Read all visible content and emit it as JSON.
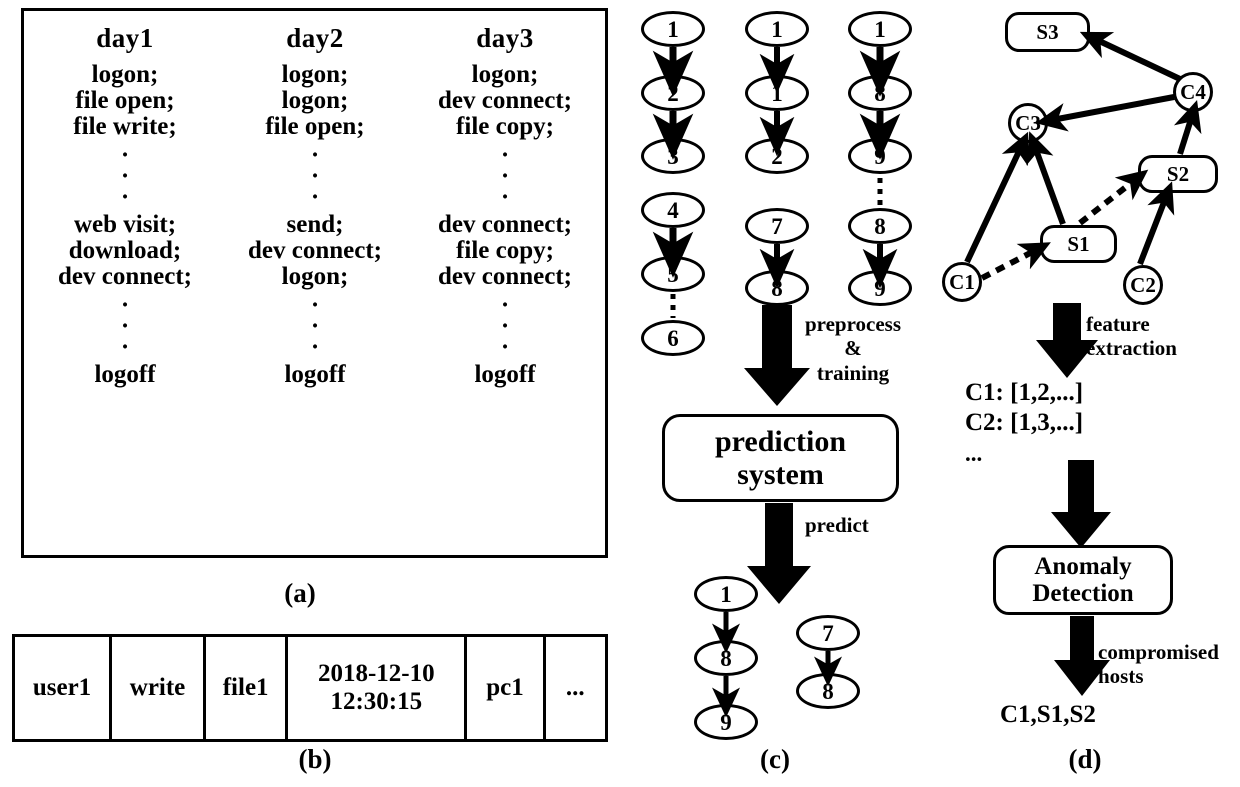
{
  "figure": {
    "panels": [
      {
        "id": "a",
        "caption": "(a)"
      },
      {
        "id": "b",
        "caption": "(b)"
      },
      {
        "id": "c",
        "caption": "(c)"
      },
      {
        "id": "d",
        "caption": "(d)"
      }
    ],
    "colors": {
      "stroke": "#000000",
      "background": "#ffffff"
    }
  },
  "panel_a": {
    "columns": [
      {
        "day": "day1",
        "entries_top": [
          "logon;",
          "file open;",
          "file write;"
        ],
        "entries_mid": [
          "web visit;",
          "download;",
          "dev connect;"
        ],
        "entry_last": "logoff",
        "dots": "·\n·\n·"
      },
      {
        "day": "day2",
        "entries_top": [
          "logon;",
          "logon;",
          "file open;"
        ],
        "entries_mid": [
          "send;",
          "dev connect;",
          "logon;"
        ],
        "entry_last": "logoff",
        "dots": "·\n·\n·"
      },
      {
        "day": "day3",
        "entries_top": [
          "logon;",
          "dev connect;",
          "file copy;"
        ],
        "entries_mid": [
          "dev connect;",
          "file copy;",
          "dev connect;"
        ],
        "entry_last": "logoff",
        "dots": "·\n·\n·"
      }
    ]
  },
  "panel_b": {
    "row": [
      "user1",
      "write",
      "file1",
      "2018-12-10\n12:30:15",
      "pc1",
      "..."
    ]
  },
  "panel_c": {
    "sequences": [
      {
        "name": "sequence-1",
        "nodes": [
          "1",
          "2",
          "3",
          "4",
          "5",
          "6"
        ],
        "links": [
          "solid",
          "solid",
          "none",
          "solid",
          "dashed"
        ]
      },
      {
        "name": "sequence-2",
        "nodes": [
          "1",
          "1",
          "2",
          "7",
          "8"
        ],
        "links": [
          "solid",
          "solid",
          "none",
          "solid"
        ]
      },
      {
        "name": "sequence-3",
        "nodes": [
          "1",
          "8",
          "9",
          "8",
          "9"
        ],
        "links": [
          "solid",
          "solid",
          "dashed",
          "solid"
        ]
      }
    ],
    "preprocess_label": "preprocess\n&\ntraining",
    "system_box": "prediction\nsystem",
    "predict_label": "predict",
    "output_sequences": [
      {
        "name": "predicted-sequence-1",
        "nodes": [
          "1",
          "8",
          "9"
        ]
      },
      {
        "name": "predicted-sequence-2",
        "nodes": [
          "7",
          "8"
        ]
      }
    ]
  },
  "panel_d": {
    "graph_nodes": [
      {
        "id": "S3",
        "label": "S3",
        "shape": "rounded-rect"
      },
      {
        "id": "C4",
        "label": "C4",
        "shape": "circle"
      },
      {
        "id": "C3",
        "label": "C3",
        "shape": "circle"
      },
      {
        "id": "S2",
        "label": "S2",
        "shape": "rounded-rect"
      },
      {
        "id": "S1",
        "label": "S1",
        "shape": "rounded-rect"
      },
      {
        "id": "C1",
        "label": "C1",
        "shape": "circle"
      },
      {
        "id": "C2",
        "label": "C2",
        "shape": "circle"
      }
    ],
    "graph_edges": [
      {
        "from": "C4",
        "to": "S3",
        "style": "solid"
      },
      {
        "from": "C4",
        "to": "C3",
        "style": "solid"
      },
      {
        "from": "C1",
        "to": "C3",
        "style": "solid"
      },
      {
        "from": "S1",
        "to": "C3",
        "style": "solid"
      },
      {
        "from": "C1",
        "to": "S1",
        "style": "dashed"
      },
      {
        "from": "S1",
        "to": "S2",
        "style": "dashed"
      },
      {
        "from": "C2",
        "to": "S2",
        "style": "solid"
      },
      {
        "from": "S2",
        "to": "C4",
        "style": "solid"
      }
    ],
    "feature_extraction_label": "feature\nextraction",
    "features": [
      "C1: [1,2,...]",
      "C2: [1,3,...]"
    ],
    "features_ellipsis": "...",
    "detection_box": "Anomaly\nDetection",
    "compromised_label": "compromised\nhosts",
    "compromised_hosts": "C1,S1,S2"
  }
}
